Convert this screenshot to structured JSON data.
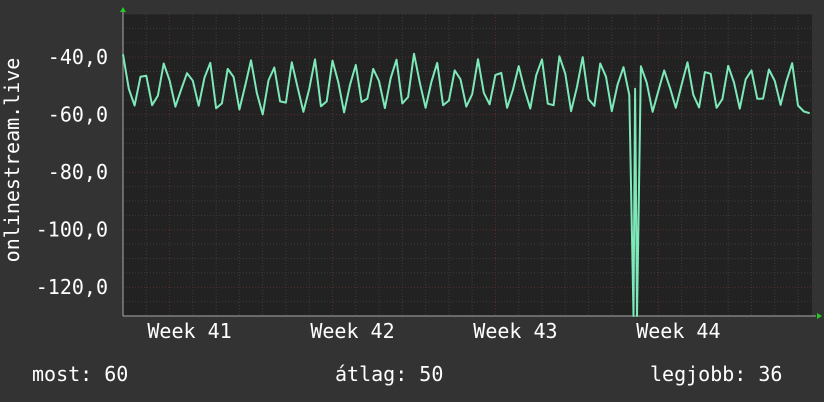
{
  "chart_data": {
    "type": "line",
    "title": "",
    "xlabel": "",
    "ylabel": "onlinestream.live",
    "ylim": [
      -130,
      -25
    ],
    "yticks": [
      -120,
      -100,
      -80,
      -60,
      -40
    ],
    "ytick_labels": [
      "-120,0",
      "-100,0",
      "-80,0",
      "-60,0",
      "-40,0"
    ],
    "xlim": [
      0,
      29.6
    ],
    "xticks": [
      2,
      9,
      16,
      23
    ],
    "xtick_labels": [
      "Week 41",
      "Week 42",
      "Week 43",
      "Week 44"
    ],
    "grid": true,
    "colors": {
      "background": "#333333",
      "plot_background": "#222222",
      "grid_minor": "#3c3c3c",
      "grid_major": "#5a2e2e",
      "line": "#7de8b8",
      "axis": "#aaaaaa",
      "arrow": "#22cc22"
    },
    "series": [
      {
        "name": "",
        "values": [
          [
            0.0,
            -39.0
          ],
          [
            0.25,
            -51.0
          ],
          [
            0.5,
            -56.8
          ],
          [
            0.75,
            -46.8
          ],
          [
            1.0,
            -46.5
          ],
          [
            1.25,
            -56.7
          ],
          [
            1.5,
            -53.4
          ],
          [
            1.75,
            -42.2
          ],
          [
            2.0,
            -48.1
          ],
          [
            2.25,
            -57.2
          ],
          [
            2.5,
            -51.2
          ],
          [
            2.75,
            -45.6
          ],
          [
            3.0,
            -48.2
          ],
          [
            3.25,
            -56.9
          ],
          [
            3.5,
            -47.1
          ],
          [
            3.75,
            -42.0
          ],
          [
            4.0,
            -57.8
          ],
          [
            4.25,
            -56.1
          ],
          [
            4.5,
            -44.1
          ],
          [
            4.75,
            -46.9
          ],
          [
            5.0,
            -58.2
          ],
          [
            5.25,
            -49.9
          ],
          [
            5.5,
            -41.1
          ],
          [
            5.75,
            -52.4
          ],
          [
            6.0,
            -59.9
          ],
          [
            6.25,
            -48.1
          ],
          [
            6.5,
            -43.6
          ],
          [
            6.75,
            -55.4
          ],
          [
            7.0,
            -55.8
          ],
          [
            7.25,
            -41.8
          ],
          [
            7.5,
            -50.5
          ],
          [
            7.75,
            -59.0
          ],
          [
            8.0,
            -51.1
          ],
          [
            8.25,
            -40.8
          ],
          [
            8.5,
            -57.1
          ],
          [
            8.75,
            -55.4
          ],
          [
            9.0,
            -41.2
          ],
          [
            9.25,
            -48.7
          ],
          [
            9.5,
            -59.2
          ],
          [
            9.75,
            -49.6
          ],
          [
            10.0,
            -42.7
          ],
          [
            10.25,
            -55.6
          ],
          [
            10.5,
            -54.4
          ],
          [
            10.75,
            -44.1
          ],
          [
            11.0,
            -48.3
          ],
          [
            11.25,
            -57.7
          ],
          [
            11.5,
            -47.3
          ],
          [
            11.75,
            -40.9
          ],
          [
            12.0,
            -56.1
          ],
          [
            12.25,
            -53.9
          ],
          [
            12.5,
            -38.8
          ],
          [
            12.75,
            -48.9
          ],
          [
            13.0,
            -57.6
          ],
          [
            13.25,
            -48.6
          ],
          [
            13.5,
            -42.0
          ],
          [
            13.75,
            -56.7
          ],
          [
            14.0,
            -55.1
          ],
          [
            14.25,
            -44.6
          ],
          [
            14.5,
            -47.7
          ],
          [
            14.75,
            -57.2
          ],
          [
            15.0,
            -52.9
          ],
          [
            15.25,
            -40.7
          ],
          [
            15.5,
            -52.4
          ],
          [
            15.75,
            -56.4
          ],
          [
            16.0,
            -46.2
          ],
          [
            16.25,
            -45.5
          ],
          [
            16.5,
            -57.6
          ],
          [
            16.75,
            -51.4
          ],
          [
            17.0,
            -43.1
          ],
          [
            17.25,
            -51.3
          ],
          [
            17.5,
            -57.9
          ],
          [
            17.75,
            -46.3
          ],
          [
            18.0,
            -40.8
          ],
          [
            18.25,
            -56.2
          ],
          [
            18.5,
            -56.7
          ],
          [
            18.75,
            -39.7
          ],
          [
            19.0,
            -45.8
          ],
          [
            19.25,
            -58.8
          ],
          [
            19.5,
            -50.5
          ],
          [
            19.75,
            -40.0
          ],
          [
            20.0,
            -54.6
          ],
          [
            20.25,
            -57.0
          ],
          [
            20.5,
            -42.2
          ],
          [
            20.75,
            -46.8
          ],
          [
            21.0,
            -58.8
          ],
          [
            21.25,
            -49.5
          ],
          [
            21.5,
            -43.5
          ],
          [
            21.75,
            -53.2
          ],
          [
            21.93,
            -130.0
          ],
          [
            22.0,
            -51.0
          ],
          [
            22.08,
            -130.0
          ],
          [
            22.25,
            -43.2
          ],
          [
            22.5,
            -48.9
          ],
          [
            22.75,
            -59.0
          ],
          [
            23.0,
            -51.7
          ],
          [
            23.25,
            -44.6
          ],
          [
            23.5,
            -50.7
          ],
          [
            23.75,
            -57.6
          ],
          [
            24.0,
            -49.6
          ],
          [
            24.25,
            -41.8
          ],
          [
            24.5,
            -53.1
          ],
          [
            24.75,
            -57.5
          ],
          [
            25.0,
            -45.2
          ],
          [
            25.25,
            -45.8
          ],
          [
            25.5,
            -57.6
          ],
          [
            25.75,
            -54.6
          ],
          [
            26.0,
            -43.0
          ],
          [
            26.25,
            -48.8
          ],
          [
            26.5,
            -57.9
          ],
          [
            26.75,
            -47.7
          ],
          [
            27.0,
            -44.6
          ],
          [
            27.25,
            -54.5
          ],
          [
            27.5,
            -54.4
          ],
          [
            27.75,
            -44.3
          ],
          [
            28.0,
            -48.3
          ],
          [
            28.25,
            -56.6
          ],
          [
            28.5,
            -48.4
          ],
          [
            28.75,
            -42.1
          ],
          [
            29.0,
            -56.8
          ],
          [
            29.25,
            -58.9
          ],
          [
            29.5,
            -59.5
          ]
        ]
      }
    ]
  },
  "stats": {
    "now": "most: 60",
    "avg": "átlag: 50",
    "max": "legjobb: 36"
  }
}
